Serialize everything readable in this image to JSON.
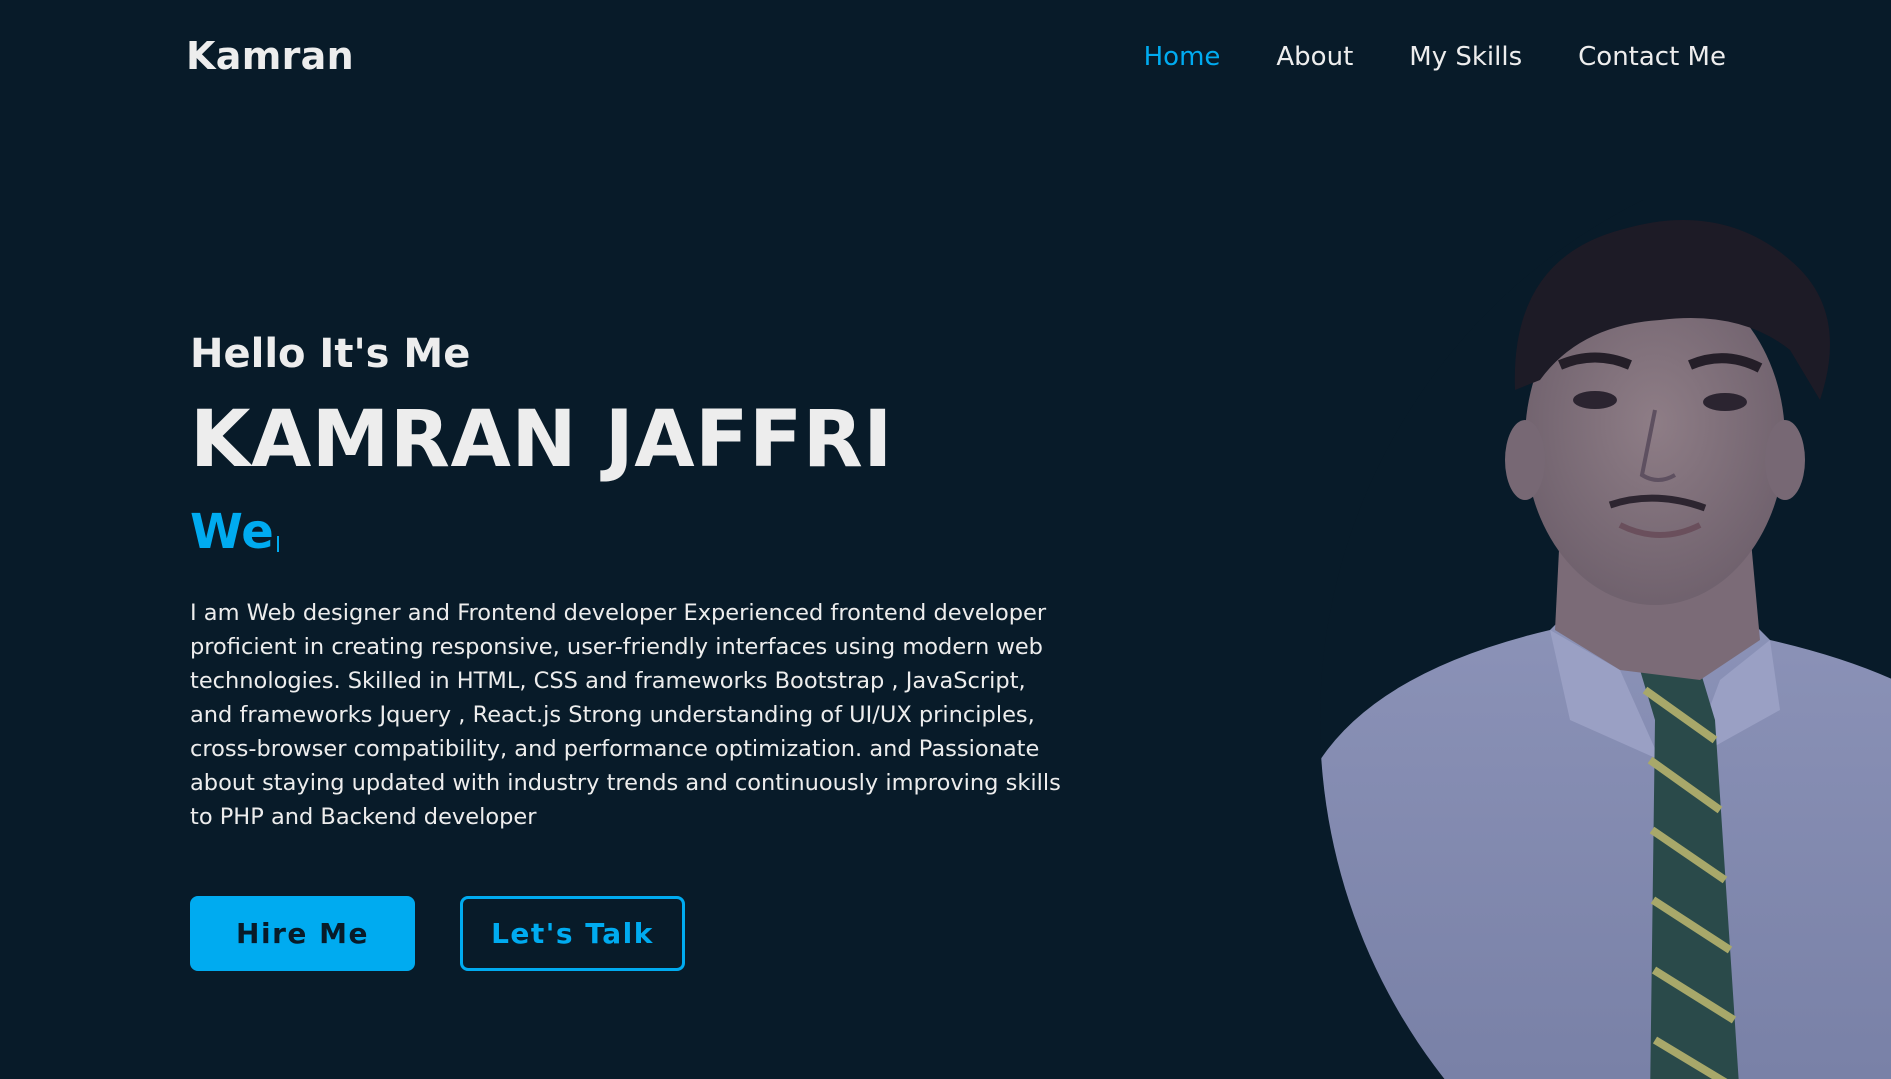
{
  "header": {
    "logo": "Kamran",
    "nav": [
      {
        "label": "Home",
        "active": true
      },
      {
        "label": "About",
        "active": false
      },
      {
        "label": "My Skills",
        "active": false
      },
      {
        "label": "Contact Me",
        "active": false
      }
    ]
  },
  "hero": {
    "greeting": "Hello It's Me",
    "name": "KAMRAN JAFFRI",
    "typing_text": "We",
    "description": "I am Web designer and Frontend developer Experienced frontend developer proficient in creating responsive, user-friendly interfaces using modern web technologies. Skilled in HTML, CSS and frameworks Bootstrap , JavaScript, and frameworks Jquery , React.js Strong understanding of UI/UX principles, cross-browser compatibility, and performance optimization. and Passionate about staying updated with industry trends and continuously improving skills to PHP and Backend developer",
    "buttons": {
      "hire": "Hire Me",
      "talk": "Let's Talk"
    }
  },
  "colors": {
    "background": "#081b29",
    "accent": "#00abf0",
    "text": "#ededed"
  },
  "icons": {
    "profile": "profile-photo"
  }
}
